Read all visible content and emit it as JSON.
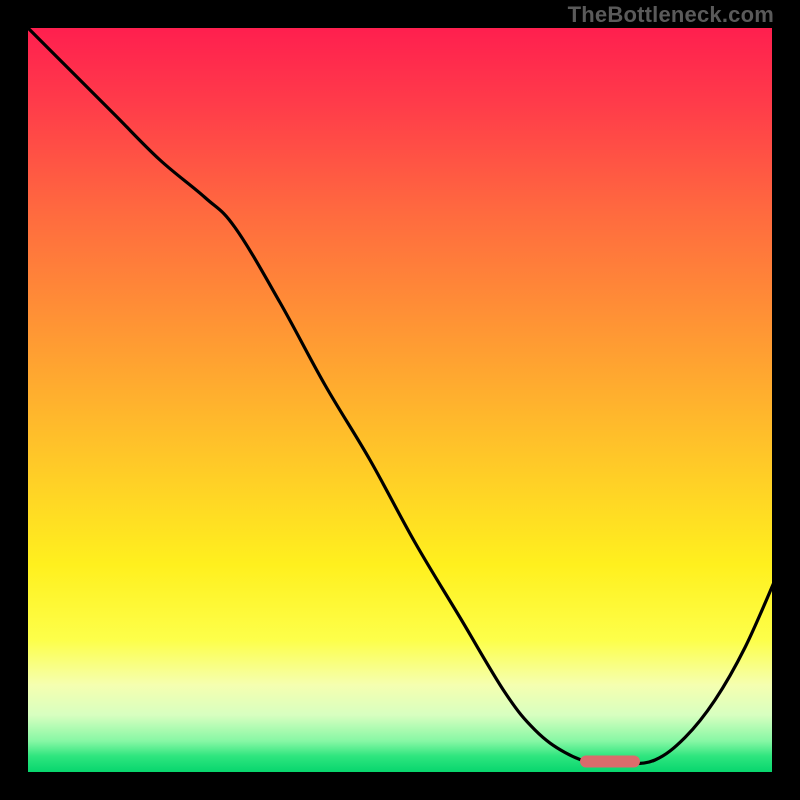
{
  "watermark": "TheBottleneck.com",
  "chart_data": {
    "type": "line",
    "title": "",
    "xlabel": "",
    "ylabel": "",
    "xlim": [
      0,
      100
    ],
    "ylim": [
      0,
      100
    ],
    "series": [
      {
        "name": "curve",
        "x": [
          0,
          6,
          12,
          18,
          24,
          28,
          34,
          40,
          46,
          52,
          58,
          64,
          68,
          72,
          76,
          80,
          84,
          88,
          92,
          96,
          100
        ],
        "y": [
          100,
          94,
          88,
          82,
          77,
          73,
          63,
          52,
          42,
          31,
          21,
          11,
          6,
          3,
          1.5,
          1.5,
          2,
          5,
          10,
          17,
          26
        ]
      }
    ],
    "marker": {
      "x": 78,
      "y": 1.8,
      "w": 8,
      "h": 1.6,
      "color": "#db6b6c"
    },
    "gradient_stops": [
      {
        "offset": 0.0,
        "color": "#ff1e4f"
      },
      {
        "offset": 0.1,
        "color": "#ff3a4a"
      },
      {
        "offset": 0.25,
        "color": "#ff6a3f"
      },
      {
        "offset": 0.42,
        "color": "#ff9a33"
      },
      {
        "offset": 0.58,
        "color": "#ffc828"
      },
      {
        "offset": 0.72,
        "color": "#fff01e"
      },
      {
        "offset": 0.82,
        "color": "#fdff4a"
      },
      {
        "offset": 0.88,
        "color": "#f5ffb0"
      },
      {
        "offset": 0.92,
        "color": "#d8ffc0"
      },
      {
        "offset": 0.955,
        "color": "#86f7a4"
      },
      {
        "offset": 0.975,
        "color": "#2ee57e"
      },
      {
        "offset": 1.0,
        "color": "#00d36b"
      }
    ]
  }
}
